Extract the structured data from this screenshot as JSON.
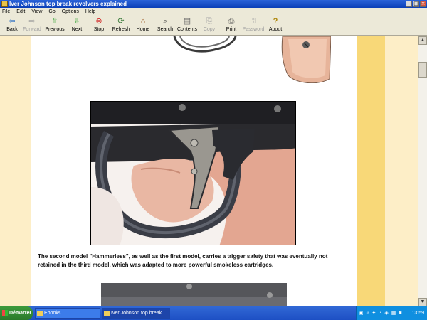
{
  "window": {
    "title": "Iver Johnson top break revolvers explained"
  },
  "menu": [
    "File",
    "Edit",
    "View",
    "Go",
    "Options",
    "Help"
  ],
  "toolbar": [
    {
      "label": "Back",
      "icon": "back-arrow-icon",
      "glyph": "⇦",
      "disabled": false
    },
    {
      "label": "Forward",
      "icon": "forward-arrow-icon",
      "glyph": "⇨",
      "disabled": true
    },
    {
      "label": "Previous",
      "icon": "previous-arrow-icon",
      "glyph": "⇧",
      "disabled": false
    },
    {
      "label": "Next",
      "icon": "next-arrow-icon",
      "glyph": "⇩",
      "disabled": false
    },
    {
      "label": "Stop",
      "icon": "stop-icon",
      "glyph": "⊗",
      "disabled": false
    },
    {
      "label": "Refresh",
      "icon": "refresh-icon",
      "glyph": "⟳",
      "disabled": false
    },
    {
      "label": "Home",
      "icon": "home-icon",
      "glyph": "⌂",
      "disabled": false
    },
    {
      "label": "Search",
      "icon": "search-icon",
      "glyph": "⌕",
      "disabled": false
    },
    {
      "label": "Contents",
      "icon": "contents-icon",
      "glyph": "▤",
      "disabled": false
    },
    {
      "label": "Copy",
      "icon": "copy-icon",
      "glyph": "⎘",
      "disabled": true
    },
    {
      "label": "Print",
      "icon": "print-icon",
      "glyph": "⎙",
      "disabled": false
    },
    {
      "label": "Password",
      "icon": "password-key-icon",
      "glyph": "⚿",
      "disabled": true
    },
    {
      "label": "About",
      "icon": "about-question-icon",
      "glyph": "?",
      "disabled": false
    }
  ],
  "content": {
    "caption": "The second model \"Hammerless\", as well as the first model, carries a trigger safety that was eventually not retained in the third model, which was adapted to more powerful smokeless cartridges."
  },
  "taskbar": {
    "start_label": "Démarrer",
    "tasks": [
      {
        "label": "Ebooks",
        "active": false
      },
      {
        "label": "Iver Johnson top break...",
        "active": true
      }
    ],
    "clock": "13:59"
  },
  "colors": {
    "page_bg": "#fdeec7",
    "side_strip": "#f8d878",
    "titlebar": "#0b3fb7"
  }
}
